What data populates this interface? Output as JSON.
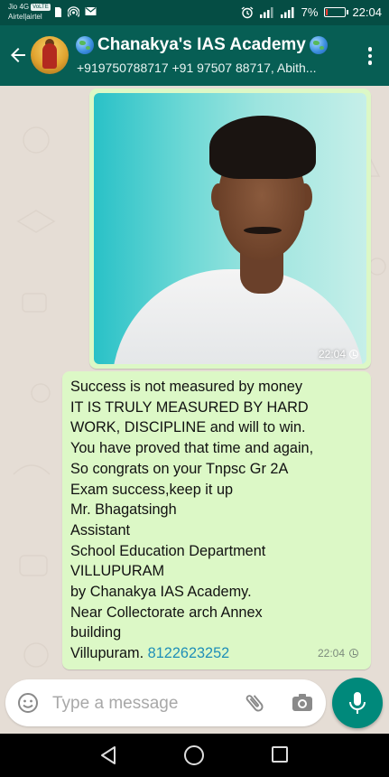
{
  "status_bar": {
    "carrier_line1": "Jio 4G",
    "volte": "VoLTE",
    "carrier_line2": "Airtel|airtel",
    "battery_percent": "7%",
    "battery_level": 0.07,
    "time": "22:04",
    "colors": {
      "background": "#054d44",
      "battery_low": "#ff3b30"
    }
  },
  "header": {
    "title": "Chanakya's IAS Academy",
    "subtitle": "+919750788717 +91 97507 88717, Abith...",
    "icons": [
      "back-arrow-icon",
      "group-avatar",
      "globe-emoji-icon",
      "more-vert-icon"
    ],
    "color": "#075e54"
  },
  "messages": [
    {
      "type": "image",
      "description_icon": "photo",
      "time": "22:04",
      "status_icon": "clock-icon"
    },
    {
      "type": "text",
      "lines": [
        "Success is not measured by money",
        "IT IS TRULY MEASURED BY HARD",
        "WORK, DISCIPLINE and will to win.",
        "You have proved that time and again,",
        "So congrats on your Tnpsc Gr 2A",
        "Exam success,keep it up",
        "Mr. Bhagatsingh",
        "Assistant",
        "School Education  Department",
        "VILLUPURAM",
        "by Chanakya IAS Academy.",
        "Near Collectorate arch Annex",
        "building"
      ],
      "last_line_prefix": "Villupuram. ",
      "phone_link": "8122623252",
      "time": "22:04",
      "status_icon": "clock-icon",
      "bubble_color": "#dcf8c6",
      "link_color": "#1f8fb8"
    }
  ],
  "composer": {
    "placeholder": "Type a message",
    "icons": [
      "emoji-icon",
      "attach-icon",
      "camera-icon",
      "mic-icon"
    ],
    "mic_button_color": "#00897b"
  },
  "nav_bar": {
    "icons": [
      "nav-back-icon",
      "nav-home-icon",
      "nav-recents-icon"
    ]
  }
}
